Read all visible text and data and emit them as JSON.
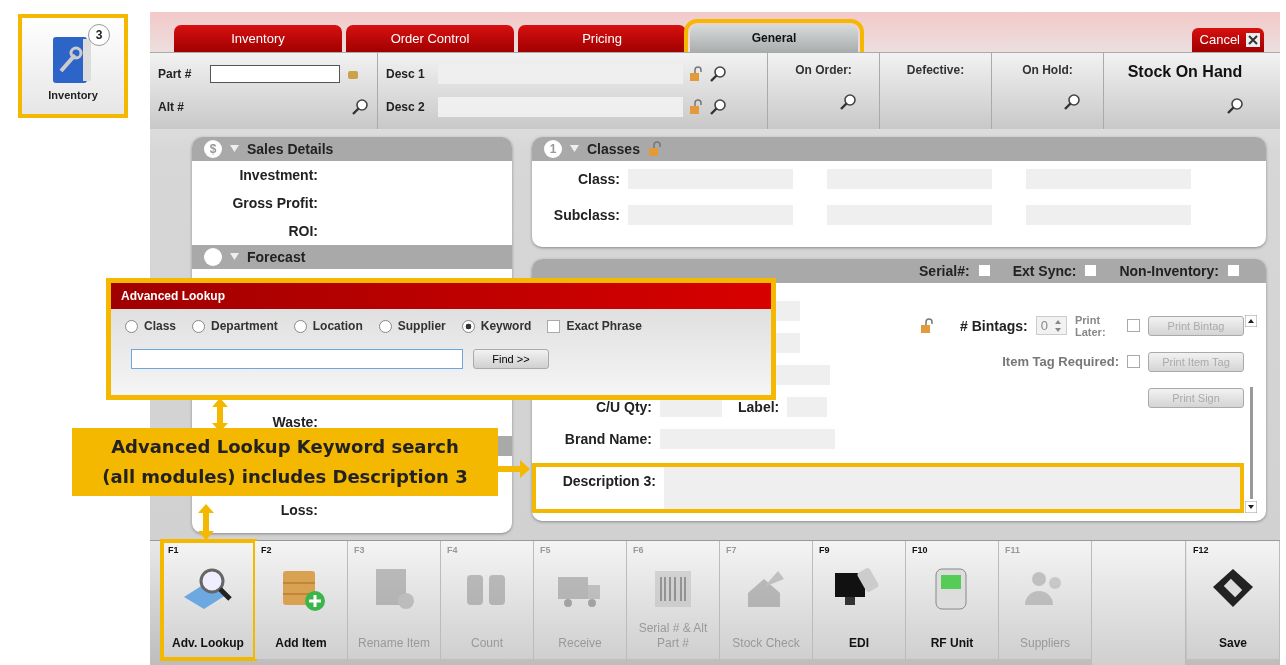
{
  "app_icon": {
    "label": "Inventory",
    "badge": "3",
    "highlighted": true
  },
  "tabs": [
    {
      "label": "Inventory",
      "selected": false,
      "highlighted": false
    },
    {
      "label": "Order Control",
      "selected": false,
      "highlighted": false
    },
    {
      "label": "Pricing",
      "selected": false,
      "highlighted": false
    },
    {
      "label": "General",
      "selected": true,
      "highlighted": true
    }
  ],
  "cancel_button": {
    "label": "Cancel"
  },
  "header": {
    "part_label": "Part #",
    "alt_label": "Alt #",
    "desc1_label": "Desc 1",
    "desc2_label": "Desc 2",
    "stats": [
      {
        "label": "On Order:",
        "searchable": true,
        "emphasis": false
      },
      {
        "label": "Defective:",
        "searchable": false,
        "emphasis": false
      },
      {
        "label": "On Hold:",
        "searchable": true,
        "emphasis": false
      },
      {
        "label": "Stock On Hand",
        "searchable": true,
        "emphasis": true
      }
    ]
  },
  "sales_details": {
    "badge": "$",
    "title": "Sales Details",
    "rows": [
      "Investment:",
      "Gross Profit:",
      "ROI:"
    ]
  },
  "forecast": {
    "title": "Forecast",
    "rows": [
      "Waste:"
    ]
  },
  "loss_section": {
    "rows": [
      "Loss:"
    ]
  },
  "classes": {
    "badge": "1",
    "title": "Classes",
    "rows": [
      "Class:",
      "Subclass:"
    ]
  },
  "details": {
    "checkboxes": [
      {
        "label": "Serial#:",
        "checked": false
      },
      {
        "label": "Ext Sync:",
        "checked": false
      },
      {
        "label": "Non-Inventory:",
        "checked": false
      }
    ],
    "qty_label": "C/U Qty:",
    "label_label": "Label:",
    "brand_label": "Brand Name:",
    "bintags": {
      "label": "# Bintags:",
      "value": "0"
    },
    "print_later": {
      "label": "Print Later:",
      "checked": false
    },
    "item_tag": {
      "label": "Item Tag Required:",
      "checked": false
    },
    "buttons": [
      {
        "label": "Print Bintag",
        "disabled": true
      },
      {
        "label": "Print Item Tag",
        "disabled": true
      },
      {
        "label": "Print Sign",
        "disabled": true
      }
    ],
    "description3": {
      "label": "Description 3:",
      "highlighted": true
    }
  },
  "dialog": {
    "title": "Advanced Lookup",
    "options": [
      {
        "label": "Class",
        "selected": false
      },
      {
        "label": "Department",
        "selected": false
      },
      {
        "label": "Location",
        "selected": false
      },
      {
        "label": "Supplier",
        "selected": false
      },
      {
        "label": "Keyword",
        "selected": true
      }
    ],
    "exact_phrase": {
      "label": "Exact Phrase",
      "checked": false
    },
    "find_button": "Find >>"
  },
  "callout": {
    "lines": [
      "Advanced Lookup Keyword  search",
      "(all modules) includes Description 3"
    ]
  },
  "toolbar": [
    {
      "kind": "button",
      "key": "F1",
      "label": "Adv. Lookup",
      "disabled": false,
      "highlighted": true
    },
    {
      "kind": "button",
      "key": "F2",
      "label": "Add Item",
      "disabled": false,
      "highlighted": false
    },
    {
      "kind": "button",
      "key": "F3",
      "label": "Rename Item",
      "disabled": true,
      "highlighted": false
    },
    {
      "kind": "button",
      "key": "F4",
      "label": "Count",
      "disabled": true,
      "highlighted": false
    },
    {
      "kind": "button",
      "key": "F5",
      "label": "Receive",
      "disabled": true,
      "highlighted": false
    },
    {
      "kind": "button",
      "key": "F6",
      "label": "Serial # & Alt Part #",
      "disabled": true,
      "highlighted": false
    },
    {
      "kind": "button",
      "key": "F7",
      "label": "Stock Check",
      "disabled": true,
      "highlighted": false
    },
    {
      "kind": "button",
      "key": "F9",
      "label": "EDI",
      "disabled": false,
      "highlighted": false
    },
    {
      "kind": "button",
      "key": "F10",
      "label": "RF Unit",
      "disabled": false,
      "highlighted": false
    },
    {
      "kind": "button",
      "key": "F11",
      "label": "Suppliers",
      "disabled": true,
      "highlighted": false
    },
    {
      "kind": "empty"
    },
    {
      "kind": "button",
      "key": "F12",
      "label": "Save",
      "disabled": false,
      "highlighted": false
    }
  ]
}
